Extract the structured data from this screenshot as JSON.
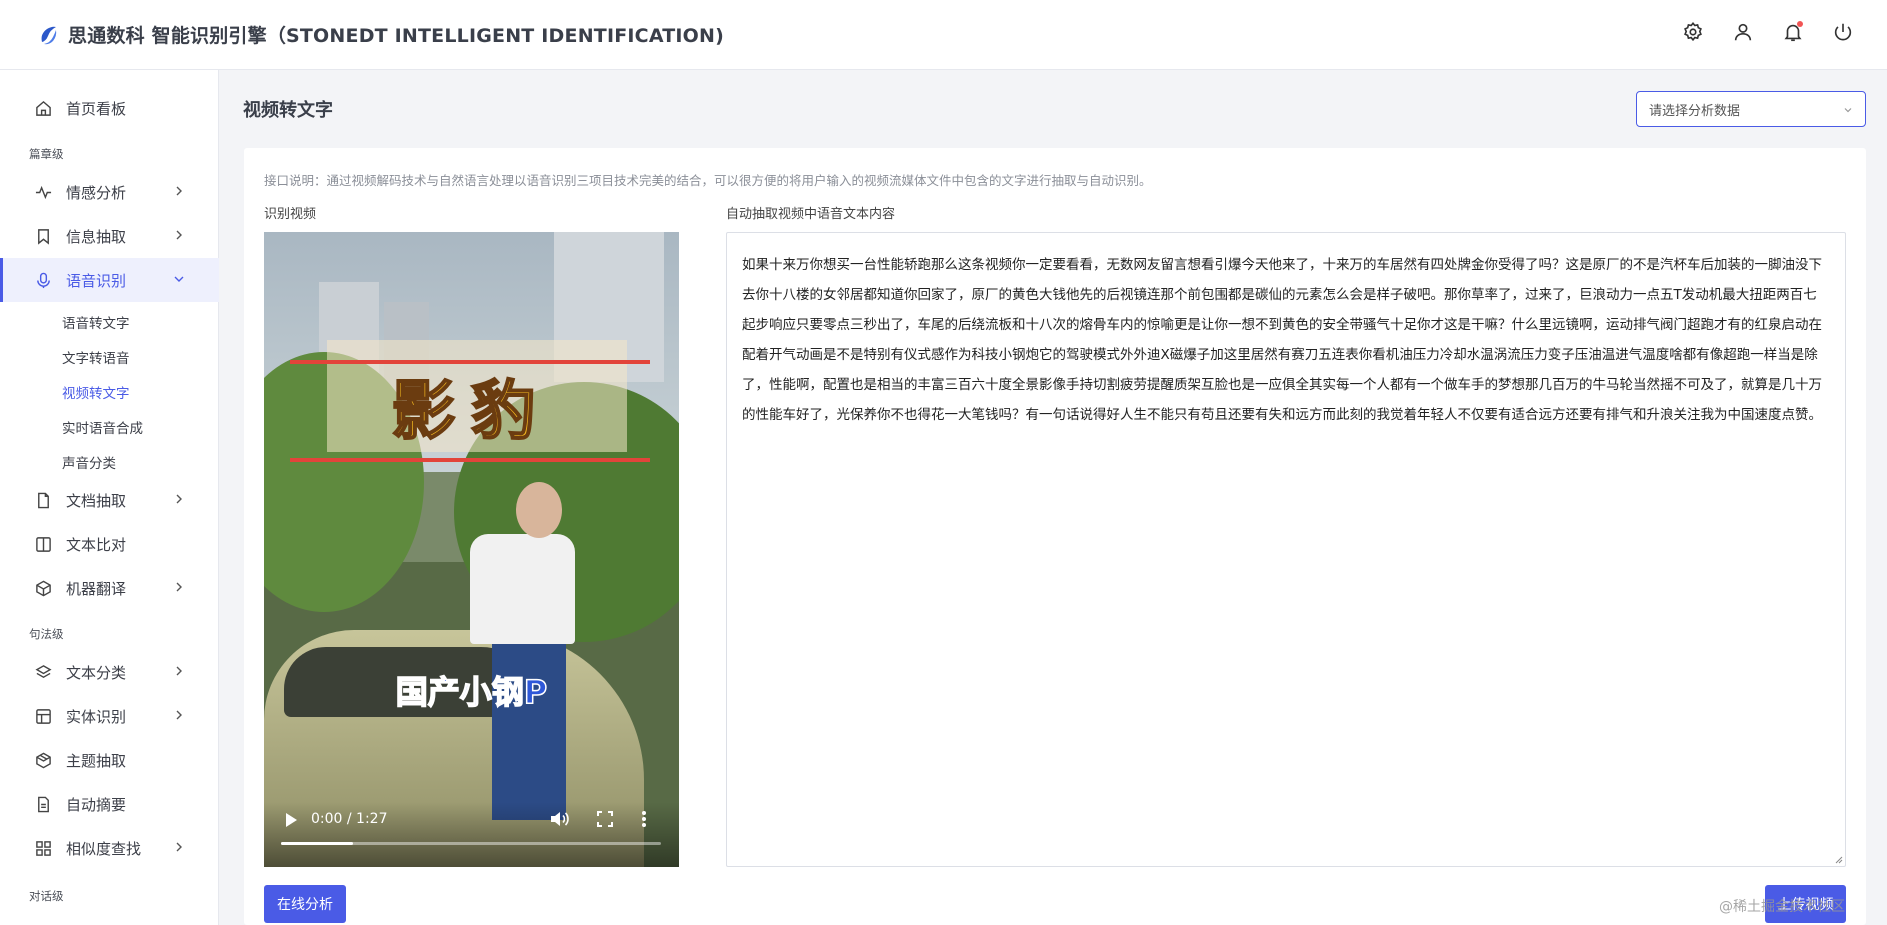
{
  "header": {
    "title": "思通数科 智能识别引擎（STONEDT INTELLIGENT IDENTIFICATION)",
    "icons": [
      "gear-icon",
      "user-icon",
      "bell-icon",
      "power-icon"
    ],
    "accent": "#4a5be6"
  },
  "sidebar": {
    "home": "首页看板",
    "group_chapter": "篇章级",
    "sentiment": "情感分析",
    "info_extract": "信息抽取",
    "speech": "语音识别",
    "sub": {
      "speech_to_text": "语音转文字",
      "text_to_speech": "文字转语音",
      "video_to_text": "视频转文字",
      "realtime_tts": "实时语音合成",
      "sound_class": "声音分类"
    },
    "doc_extract": "文档抽取",
    "text_compare": "文本比对",
    "machine_translate": "机器翻译",
    "group_sentence": "句法级",
    "text_class": "文本分类",
    "entity": "实体识别",
    "topic": "主题抽取",
    "summary": "自动摘要",
    "similarity": "相似度查找",
    "group_dialog": "对话级"
  },
  "main": {
    "page_title": "视频转文字",
    "select_placeholder": "请选择分析数据",
    "description": "接口说明：通过视频解码技术与自然语言处理以语音识别三项目技术完美的结合，可以很方便的将用户输入的视频流媒体文件中包含的文字进行抽取与自动识别。",
    "video_label": "识别视频",
    "text_label": "自动抽取视频中语音文本内容",
    "video": {
      "title_overlay": "影豹",
      "subtitle_overlay": "国产小钢P",
      "time": "0:00 / 1:27",
      "progress": 0.19
    },
    "transcript": "如果十来万你想买一台性能轿跑那么这条视频你一定要看看，无数网友留言想看引爆今天他来了，十来万的车居然有四处牌金你受得了吗？这是原厂的不是汽杯车后加装的一脚油没下去你十八楼的女邻居都知道你回家了，原厂的黄色大钱他先的后视镜连那个前包围都是碳仙的元素怎么会是样子破吧。那你草率了，过来了，巨浪动力一点五T发动机最大扭距两百七起步响应只要零点三秒出了，车尾的后绕流板和十八次的熔骨车内的惊喻更是让你一想不到黄色的安全带骚气十足你才这是干嘛？什么里远镜啊，运动排气阀门超跑才有的红泉启动在配着开气动画是不是特别有仪式感作为科技小钢炮它的驾驶模式外外迪X磁爆子加这里居然有赛刀五连表你看机油压力冷却水温涡流压力变子压油温进气温度啥都有像超跑一样当是除了，性能啊，配置也是相当的丰富三百六十度全景影像手持切割疲劳提醒质架互脸也是一应俱全其实每一个人都有一个做车手的梦想那几百万的牛马轮当然摇不可及了，就算是几十万的性能车好了，光保养你不也得花一大笔钱吗？有一句话说得好人生不能只有苟且还要有失和远方而此刻的我觉着年轻人不仅要有适合远方还要有排气和升浪关注我为中国速度点赞。",
    "analyze_button": "在线分析",
    "upload_button": "上传视频",
    "watermark": "@稀土掘金技术社区"
  }
}
